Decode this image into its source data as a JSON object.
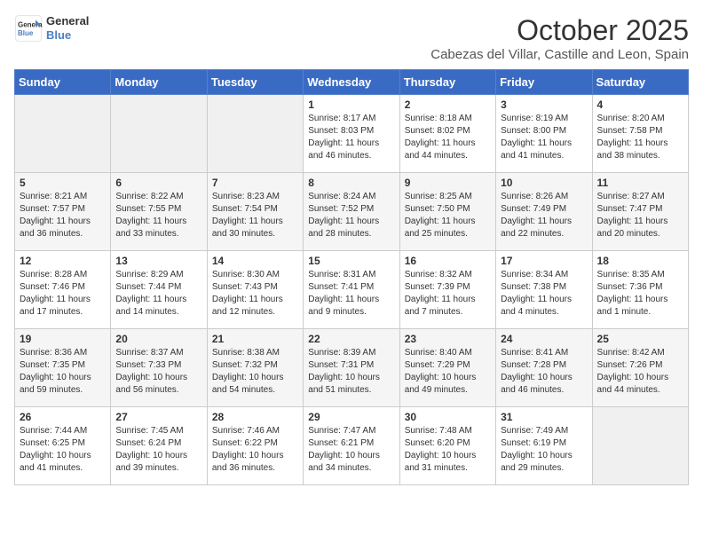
{
  "header": {
    "logo_line1": "General",
    "logo_line2": "Blue",
    "month": "October 2025",
    "location": "Cabezas del Villar, Castille and Leon, Spain"
  },
  "weekdays": [
    "Sunday",
    "Monday",
    "Tuesday",
    "Wednesday",
    "Thursday",
    "Friday",
    "Saturday"
  ],
  "weeks": [
    [
      {
        "day": "",
        "info": ""
      },
      {
        "day": "",
        "info": ""
      },
      {
        "day": "",
        "info": ""
      },
      {
        "day": "1",
        "info": "Sunrise: 8:17 AM\nSunset: 8:03 PM\nDaylight: 11 hours and 46 minutes."
      },
      {
        "day": "2",
        "info": "Sunrise: 8:18 AM\nSunset: 8:02 PM\nDaylight: 11 hours and 44 minutes."
      },
      {
        "day": "3",
        "info": "Sunrise: 8:19 AM\nSunset: 8:00 PM\nDaylight: 11 hours and 41 minutes."
      },
      {
        "day": "4",
        "info": "Sunrise: 8:20 AM\nSunset: 7:58 PM\nDaylight: 11 hours and 38 minutes."
      }
    ],
    [
      {
        "day": "5",
        "info": "Sunrise: 8:21 AM\nSunset: 7:57 PM\nDaylight: 11 hours and 36 minutes."
      },
      {
        "day": "6",
        "info": "Sunrise: 8:22 AM\nSunset: 7:55 PM\nDaylight: 11 hours and 33 minutes."
      },
      {
        "day": "7",
        "info": "Sunrise: 8:23 AM\nSunset: 7:54 PM\nDaylight: 11 hours and 30 minutes."
      },
      {
        "day": "8",
        "info": "Sunrise: 8:24 AM\nSunset: 7:52 PM\nDaylight: 11 hours and 28 minutes."
      },
      {
        "day": "9",
        "info": "Sunrise: 8:25 AM\nSunset: 7:50 PM\nDaylight: 11 hours and 25 minutes."
      },
      {
        "day": "10",
        "info": "Sunrise: 8:26 AM\nSunset: 7:49 PM\nDaylight: 11 hours and 22 minutes."
      },
      {
        "day": "11",
        "info": "Sunrise: 8:27 AM\nSunset: 7:47 PM\nDaylight: 11 hours and 20 minutes."
      }
    ],
    [
      {
        "day": "12",
        "info": "Sunrise: 8:28 AM\nSunset: 7:46 PM\nDaylight: 11 hours and 17 minutes."
      },
      {
        "day": "13",
        "info": "Sunrise: 8:29 AM\nSunset: 7:44 PM\nDaylight: 11 hours and 14 minutes."
      },
      {
        "day": "14",
        "info": "Sunrise: 8:30 AM\nSunset: 7:43 PM\nDaylight: 11 hours and 12 minutes."
      },
      {
        "day": "15",
        "info": "Sunrise: 8:31 AM\nSunset: 7:41 PM\nDaylight: 11 hours and 9 minutes."
      },
      {
        "day": "16",
        "info": "Sunrise: 8:32 AM\nSunset: 7:39 PM\nDaylight: 11 hours and 7 minutes."
      },
      {
        "day": "17",
        "info": "Sunrise: 8:34 AM\nSunset: 7:38 PM\nDaylight: 11 hours and 4 minutes."
      },
      {
        "day": "18",
        "info": "Sunrise: 8:35 AM\nSunset: 7:36 PM\nDaylight: 11 hours and 1 minute."
      }
    ],
    [
      {
        "day": "19",
        "info": "Sunrise: 8:36 AM\nSunset: 7:35 PM\nDaylight: 10 hours and 59 minutes."
      },
      {
        "day": "20",
        "info": "Sunrise: 8:37 AM\nSunset: 7:33 PM\nDaylight: 10 hours and 56 minutes."
      },
      {
        "day": "21",
        "info": "Sunrise: 8:38 AM\nSunset: 7:32 PM\nDaylight: 10 hours and 54 minutes."
      },
      {
        "day": "22",
        "info": "Sunrise: 8:39 AM\nSunset: 7:31 PM\nDaylight: 10 hours and 51 minutes."
      },
      {
        "day": "23",
        "info": "Sunrise: 8:40 AM\nSunset: 7:29 PM\nDaylight: 10 hours and 49 minutes."
      },
      {
        "day": "24",
        "info": "Sunrise: 8:41 AM\nSunset: 7:28 PM\nDaylight: 10 hours and 46 minutes."
      },
      {
        "day": "25",
        "info": "Sunrise: 8:42 AM\nSunset: 7:26 PM\nDaylight: 10 hours and 44 minutes."
      }
    ],
    [
      {
        "day": "26",
        "info": "Sunrise: 7:44 AM\nSunset: 6:25 PM\nDaylight: 10 hours and 41 minutes."
      },
      {
        "day": "27",
        "info": "Sunrise: 7:45 AM\nSunset: 6:24 PM\nDaylight: 10 hours and 39 minutes."
      },
      {
        "day": "28",
        "info": "Sunrise: 7:46 AM\nSunset: 6:22 PM\nDaylight: 10 hours and 36 minutes."
      },
      {
        "day": "29",
        "info": "Sunrise: 7:47 AM\nSunset: 6:21 PM\nDaylight: 10 hours and 34 minutes."
      },
      {
        "day": "30",
        "info": "Sunrise: 7:48 AM\nSunset: 6:20 PM\nDaylight: 10 hours and 31 minutes."
      },
      {
        "day": "31",
        "info": "Sunrise: 7:49 AM\nSunset: 6:19 PM\nDaylight: 10 hours and 29 minutes."
      },
      {
        "day": "",
        "info": ""
      }
    ]
  ]
}
